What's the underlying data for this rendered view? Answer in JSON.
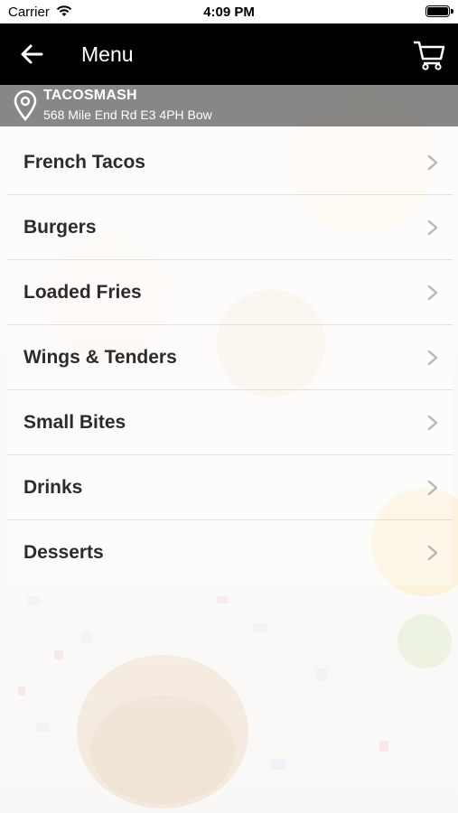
{
  "status_bar": {
    "carrier": "Carrier",
    "time": "4:09 PM"
  },
  "nav": {
    "title": "Menu",
    "back_icon": "arrow-left-icon",
    "cart_icon": "shopping-cart-icon"
  },
  "store": {
    "name": "TACOSMASH",
    "address": "568 Mile End Rd E3 4PH Bow",
    "icon": "location-pin-icon"
  },
  "menu": {
    "items": [
      {
        "label": "French Tacos"
      },
      {
        "label": "Burgers"
      },
      {
        "label": "Loaded Fries"
      },
      {
        "label": "Wings & Tenders"
      },
      {
        "label": "Small Bites"
      },
      {
        "label": "Drinks"
      },
      {
        "label": "Desserts"
      }
    ]
  },
  "colors": {
    "nav_bg": "#000000",
    "banner_bg": "#5a5a5a",
    "text": "#2b2b2b",
    "chevron": "#b5b5b5"
  }
}
